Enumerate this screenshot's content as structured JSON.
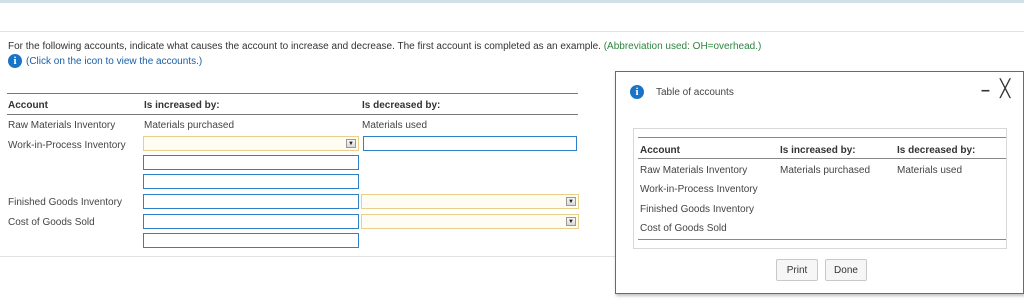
{
  "instructions": {
    "text": "For the following accounts, indicate what causes the account to increase and decrease. The first account is completed as an example.",
    "abbreviation": "(Abbreviation used: OH=overhead.)",
    "hint": "(Click on the icon to view the accounts.)",
    "info_icon": "i"
  },
  "main_table": {
    "headers": {
      "account": "Account",
      "increased": "Is increased by:",
      "decreased": "Is decreased by:"
    },
    "rows": [
      {
        "account": "Raw Materials Inventory",
        "increased": "Materials purchased",
        "decreased": "Materials used"
      },
      {
        "account": "Work-in-Process Inventory",
        "increased": "",
        "decreased": ""
      },
      {
        "account": "Finished Goods Inventory",
        "increased": "",
        "decreased": ""
      },
      {
        "account": "Cost of Goods Sold",
        "increased": "",
        "decreased": ""
      }
    ],
    "dropdown_arrow": "▼"
  },
  "popup": {
    "info_icon": "i",
    "title": "Table of accounts",
    "minimize": "–",
    "close": "╳",
    "headers": {
      "account": "Account",
      "increased": "Is increased by:",
      "decreased": "Is decreased by:"
    },
    "rows": [
      {
        "account": "Raw Materials Inventory",
        "increased": "Materials purchased",
        "decreased": "Materials used"
      },
      {
        "account": "Work-in-Process Inventory",
        "increased": "",
        "decreased": ""
      },
      {
        "account": "Finished Goods Inventory",
        "increased": "",
        "decreased": ""
      },
      {
        "account": "Cost of Goods Sold",
        "increased": "",
        "decreased": ""
      }
    ],
    "print_label": "Print",
    "done_label": "Done"
  },
  "colors": {
    "input_border": "#2f7fc9",
    "dropdown_border": "#e8d08a",
    "info_icon": "#1a73c7",
    "abbreviation_text": "#2e8540",
    "hint_text": "#1a5fa8"
  }
}
